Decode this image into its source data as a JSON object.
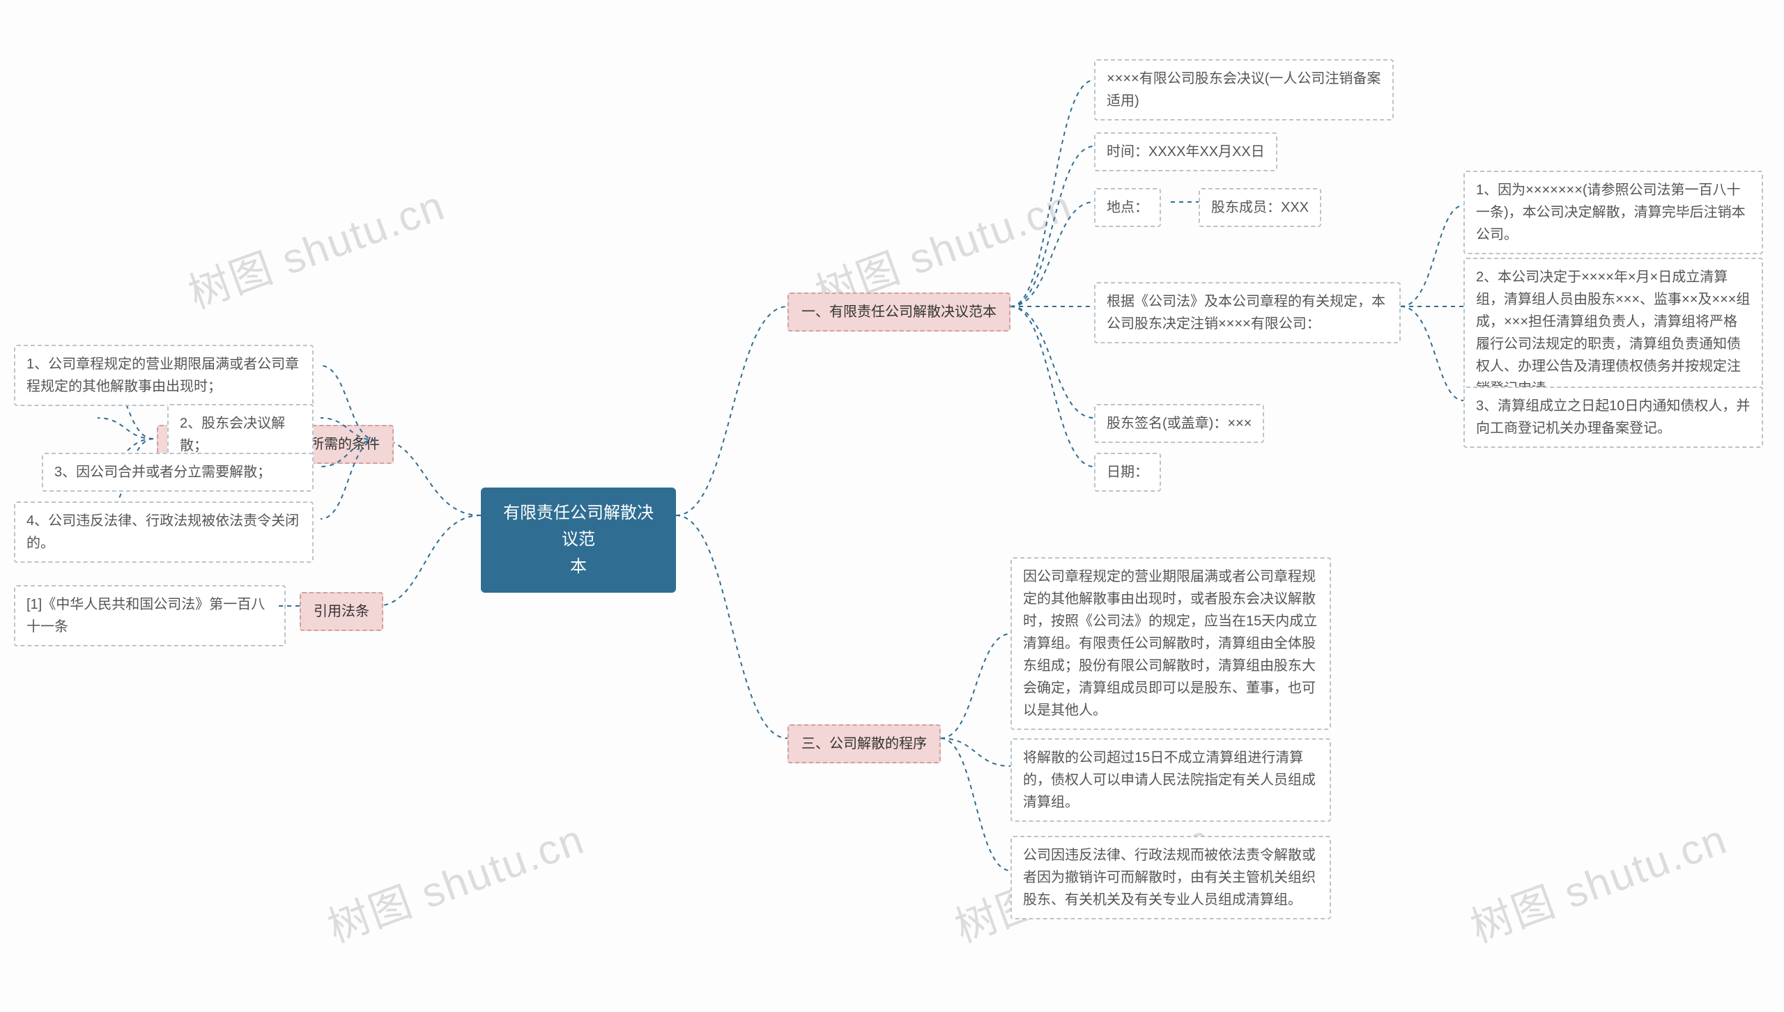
{
  "root": {
    "line1": "有限责任公司解散决议范",
    "line2": "本"
  },
  "sections": {
    "s1": {
      "title": "一、有限责任公司解散决议范本",
      "children": {
        "c1": "××××有限公司股东会决议(一人公司注销备案适用)",
        "c2": "时间：XXXX年XX月XX日",
        "c3": "地点：",
        "c3b": "股东成员：XXX",
        "c4": "根据《公司法》及本公司章程的有关规定，本公司股东决定注销××××有限公司：",
        "c4_children": {
          "d1": "1、因为×××××××(请参照公司法第一百八十一条)，本公司决定解散，清算完毕后注销本公司。",
          "d2": "2、本公司决定于××××年×月×日成立清算组，清算组人员由股东×××、监事××及×××组成，×××担任清算组负责人，清算组将严格履行公司法规定的职责，清算组负责通知债权人、办理公告及清理债权债务并按规定注销登记申请。",
          "d3": "3、清算组成立之日起10日内通知债权人，并向工商登记机关办理备案登记。"
        },
        "c5": "股东签名(或盖章)：×××",
        "c6": "日期："
      }
    },
    "s2": {
      "title": "二、有限责任公司解散所需的条件",
      "children": {
        "c1": "1、公司章程规定的营业期限届满或者公司章程规定的其他解散事由出现时；",
        "c2": "2、股东会决议解散；",
        "c3": "3、因公司合并或者分立需要解散；",
        "c4": "4、公司违反法律、行政法规被依法责令关闭的。"
      }
    },
    "s3": {
      "title": "三、公司解散的程序",
      "children": {
        "c1": "因公司章程规定的营业期限届满或者公司章程规定的其他解散事由出现时，或者股东会决议解散时，按照《公司法》的规定，应当在15天内成立清算组。有限责任公司解散时，清算组由全体股东组成；股份有限公司解散时，清算组由股东大会确定，清算组成员即可以是股东、董事，也可以是其他人。",
        "c2": "将解散的公司超过15日不成立清算组进行清算的，债权人可以申请人民法院指定有关人员组成清算组。",
        "c3": "公司因违反法律、行政法规而被依法责令解散或者因为撤销许可而解散时，由有关主管机关组织股东、有关机关及有关专业人员组成清算组。"
      }
    },
    "s4": {
      "title": "引用法条",
      "children": {
        "c1": "[1]《中华人民共和国公司法》第一百八十一条"
      }
    }
  },
  "watermark": "树图 shutu.cn"
}
